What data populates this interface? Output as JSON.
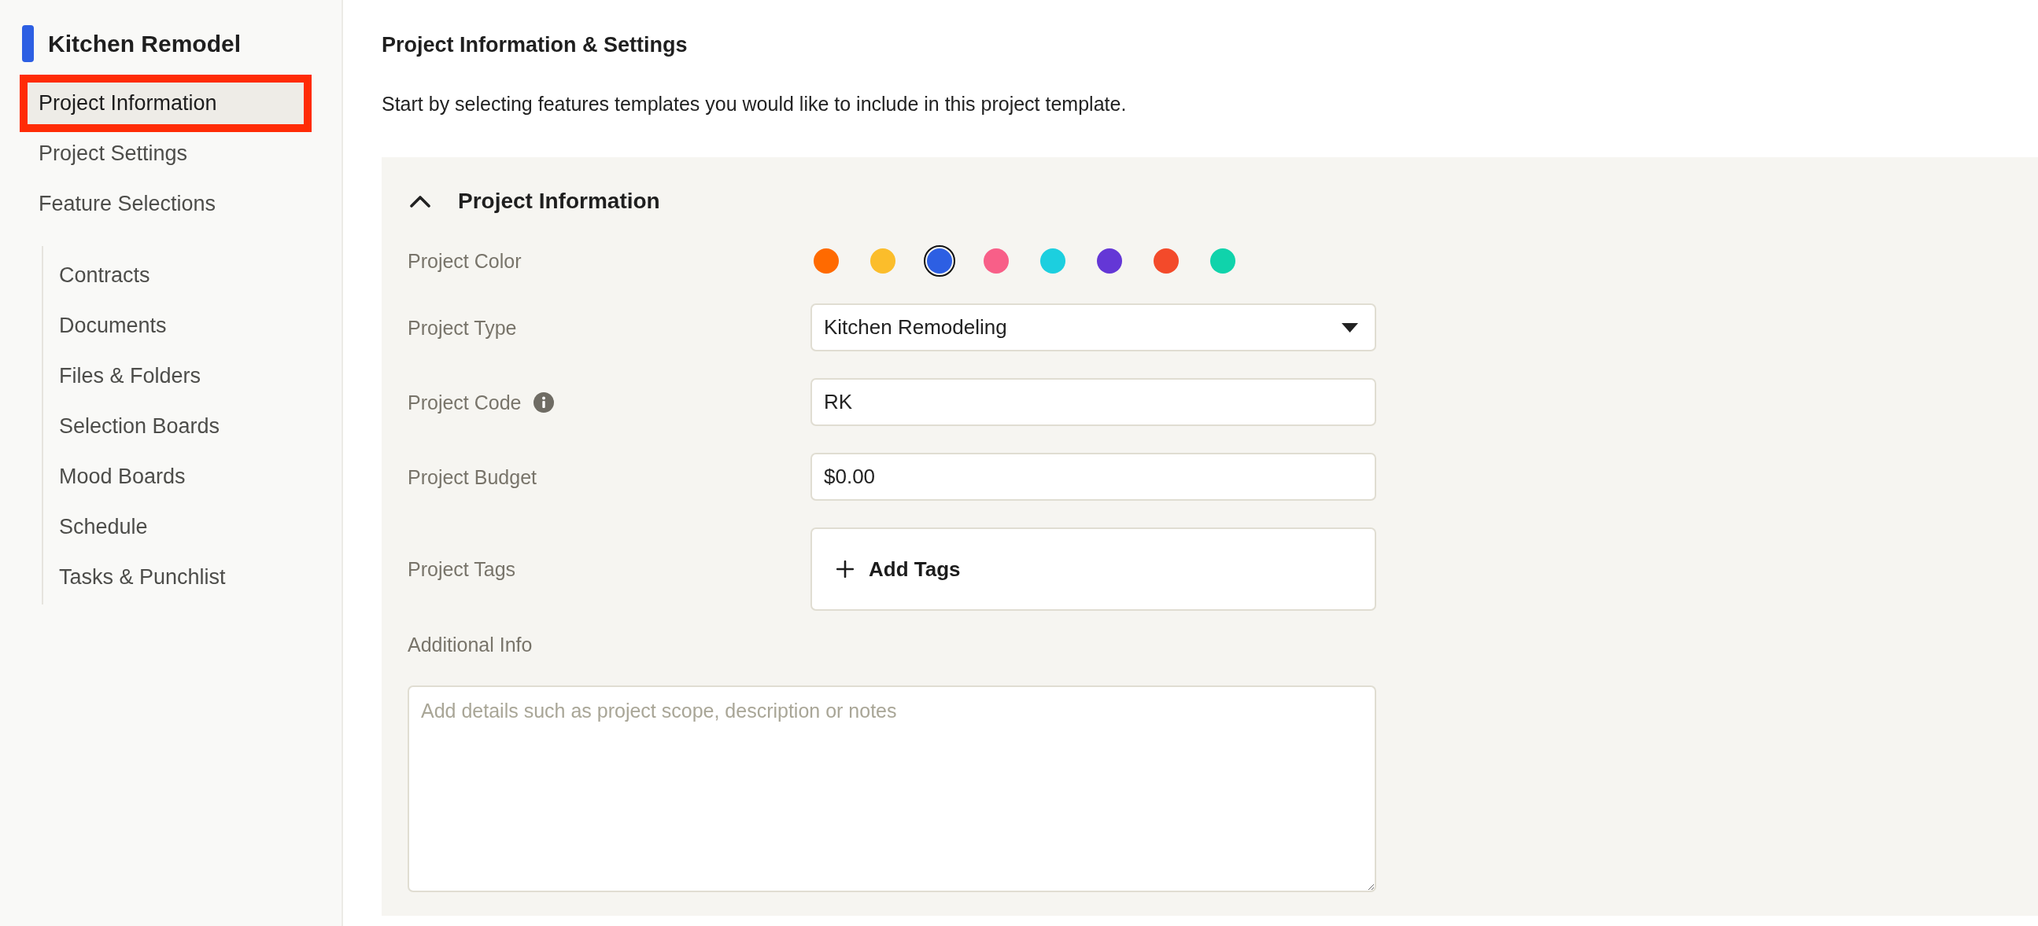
{
  "sidebar": {
    "title": "Kitchen Remodel",
    "items": [
      {
        "label": "Project Information",
        "selected": true,
        "highlighted": true
      },
      {
        "label": "Project Settings",
        "selected": false,
        "highlighted": false
      },
      {
        "label": "Feature Selections",
        "selected": false,
        "highlighted": false,
        "children": [
          {
            "label": "Contracts",
            "selected": false
          },
          {
            "label": "Documents",
            "selected": false
          },
          {
            "label": "Files & Folders",
            "selected": false
          },
          {
            "label": "Selection Boards",
            "selected": false
          },
          {
            "label": "Mood Boards",
            "selected": false
          },
          {
            "label": "Schedule",
            "selected": false
          },
          {
            "label": "Tasks & Punchlist",
            "selected": false
          }
        ]
      }
    ]
  },
  "main": {
    "title": "Project Information & Settings",
    "subtitle": "Start by selecting features templates you would like to include in this project template."
  },
  "section": {
    "title": "Project Information",
    "expanded": true,
    "fields": [
      {
        "kind": "colors",
        "label": "Project Color",
        "info": false,
        "swatches": [
          {
            "color": "#ff6a00",
            "selected": false
          },
          {
            "color": "#fbbd2b",
            "selected": false
          },
          {
            "color": "#2d5fe3",
            "selected": true
          },
          {
            "color": "#f85f88",
            "selected": false
          },
          {
            "color": "#1ccfdf",
            "selected": false
          },
          {
            "color": "#6437d6",
            "selected": false
          },
          {
            "color": "#f34a2a",
            "selected": false
          },
          {
            "color": "#10d3ab",
            "selected": false
          }
        ]
      },
      {
        "kind": "select",
        "label": "Project Type",
        "info": false,
        "value": "Kitchen Remodeling"
      },
      {
        "kind": "text",
        "label": "Project Code",
        "info": true,
        "value": "RK"
      },
      {
        "kind": "text",
        "label": "Project Budget",
        "info": false,
        "value": "$0.00"
      },
      {
        "kind": "tags",
        "label": "Project Tags",
        "info": false,
        "button": "Add Tags"
      },
      {
        "kind": "textarea",
        "label": "Additional Info",
        "info": false,
        "placeholder": "Add details such as project scope, description or notes"
      }
    ]
  }
}
